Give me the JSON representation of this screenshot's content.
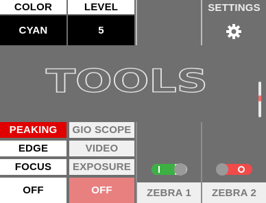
{
  "top": {
    "color": {
      "label": "COLOR",
      "value": "CYAN"
    },
    "level": {
      "label": "LEVEL",
      "value": "5"
    },
    "settings": {
      "label": "SETTINGS",
      "icon": "gear-icon"
    }
  },
  "title": "TOOLS",
  "left_menu": {
    "items": [
      {
        "label": "PEAKING",
        "active": true,
        "active_color": "#e00000"
      },
      {
        "label": "EDGE"
      },
      {
        "label": "FOCUS"
      },
      {
        "label": "OFF"
      }
    ]
  },
  "mid_menu": {
    "items": [
      {
        "label": "GIO SCOPE"
      },
      {
        "label": "VIDEO"
      },
      {
        "label": "EXPOSURE"
      },
      {
        "label": "OFF",
        "active": true,
        "active_color": "#e88080"
      }
    ]
  },
  "zebra": [
    {
      "label": "ZEBRA 1",
      "state": "on",
      "track_color": "#3cb043"
    },
    {
      "label": "ZEBRA 2",
      "state": "off",
      "track_color": "#f24a4a"
    }
  ],
  "colors": {
    "background": "#6f6f6f",
    "accent_red": "#e00000",
    "accent_pink": "#e88080",
    "toggle_green": "#3cb043",
    "toggle_red": "#f24a4a"
  }
}
